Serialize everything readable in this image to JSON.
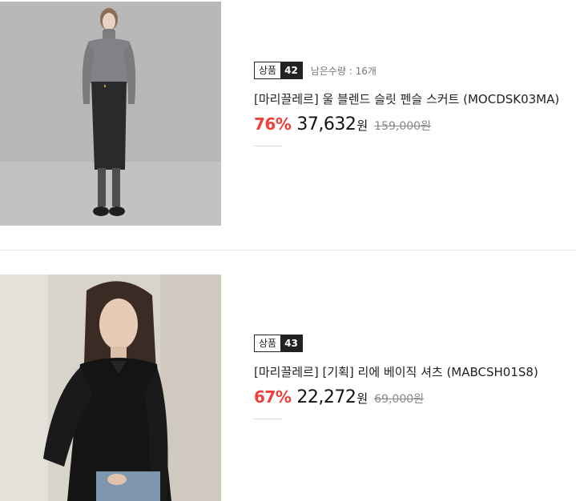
{
  "products": [
    {
      "badge_label": "상품",
      "badge_number": "42",
      "stock": "남은수량 : 16개",
      "title": "[마리끌레르] 울 블렌드 슬릿 펜슬 스커트 (MOCDSK03MA)",
      "discount": "76%",
      "price": "37,632",
      "currency": "원",
      "original_price": "159,000원"
    },
    {
      "badge_label": "상품",
      "badge_number": "43",
      "stock": "",
      "title": "[마리끌레르] [기획] 리에 베이직 셔츠 (MABCSH01S8)",
      "discount": "67%",
      "price": "22,272",
      "currency": "원",
      "original_price": "69,000원"
    }
  ],
  "colors": {
    "discount": "#f0403a",
    "badge_dark": "#222222",
    "text_muted": "#888888"
  }
}
